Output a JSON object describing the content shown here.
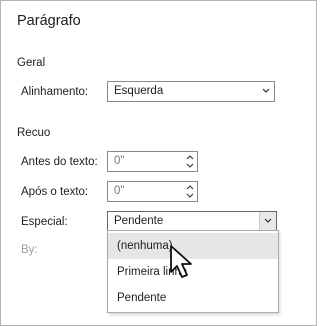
{
  "dialog": {
    "title": "Parágrafo"
  },
  "general": {
    "heading": "Geral",
    "alignment_label": "Alinhamento:",
    "alignment_value": "Esquerda"
  },
  "indent": {
    "heading": "Recuo",
    "before_label": "Antes do texto:",
    "before_value": "0\"",
    "after_label": "Após o texto:",
    "after_value": "0\"",
    "special_label": "Especial:",
    "special_value": "Pendente",
    "by_label": "By:"
  },
  "special_options": [
    "(nenhuma)",
    "Primeira linha",
    "Pendente"
  ],
  "icons": {
    "dropdown": "chevron-down-icon",
    "spinner": "spinner-arrows-icon",
    "cursor": "mouse-pointer-icon"
  }
}
